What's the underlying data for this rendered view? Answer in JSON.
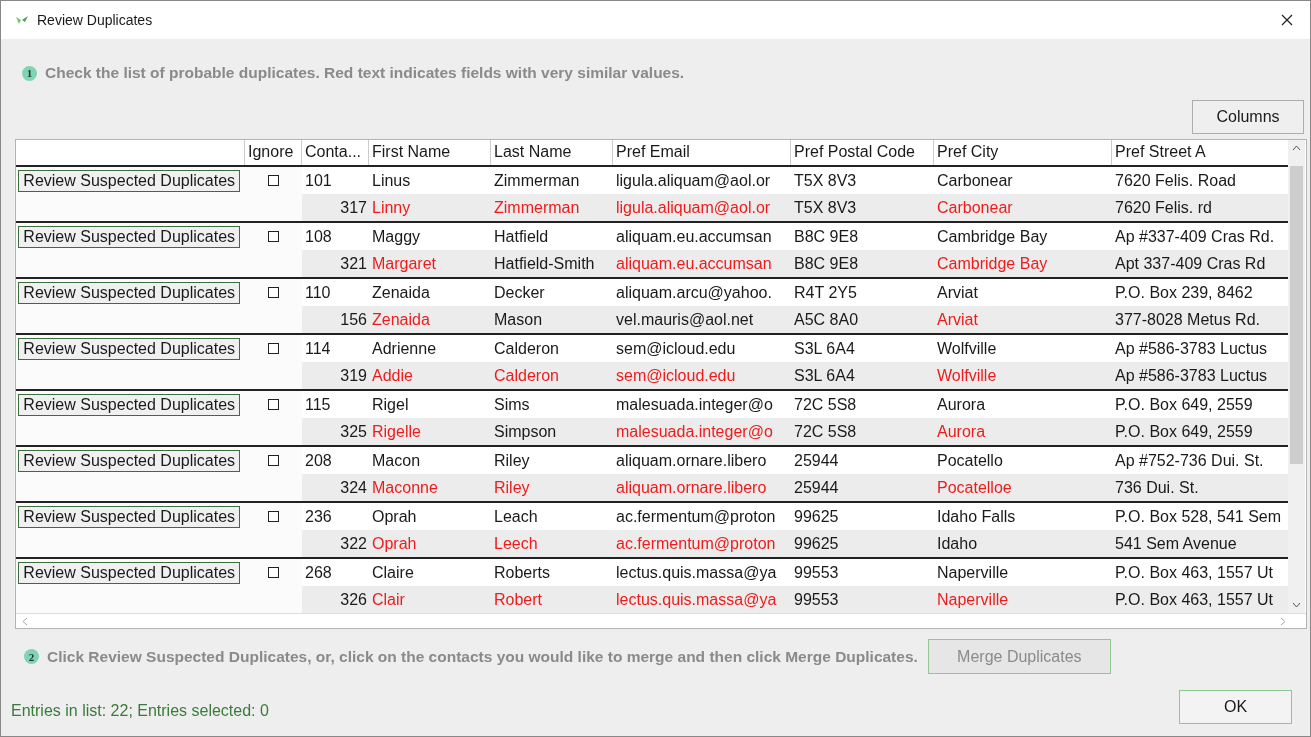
{
  "window": {
    "title": "Review Duplicates"
  },
  "step1": {
    "number": "1",
    "text": "Check the list of probable duplicates. Red text indicates fields with very similar values."
  },
  "columns_button": "Columns",
  "table": {
    "columns": [
      "Ignore",
      "Conta...",
      "First Name",
      "Last Name",
      "Pref Email",
      "Pref Postal Code",
      "Pref City",
      "Pref Street A"
    ],
    "groups": [
      {
        "review_button": "Review Suspected Duplicates",
        "ignored": false,
        "contact": [
          "101",
          "Linus",
          "Zimmerman",
          "ligula.aliquam@aol.or",
          "T5X 8V3",
          "Carbonear",
          "7620 Felis. Road"
        ],
        "duplicate": [
          {
            "text": "317",
            "similar": false
          },
          {
            "text": "Linny",
            "similar": true
          },
          {
            "text": "Zimmerman",
            "similar": true
          },
          {
            "text": "ligula.aliquam@aol.or",
            "similar": true
          },
          {
            "text": "T5X 8V3",
            "similar": false
          },
          {
            "text": "Carbonear",
            "similar": true
          },
          {
            "text": "7620 Felis. rd",
            "similar": false
          }
        ]
      },
      {
        "review_button": "Review Suspected Duplicates",
        "ignored": false,
        "contact": [
          "108",
          "Maggy",
          "Hatfield",
          "aliquam.eu.accumsan",
          "B8C 9E8",
          "Cambridge Bay",
          "Ap #337-409 Cras Rd."
        ],
        "duplicate": [
          {
            "text": "321",
            "similar": false
          },
          {
            "text": "Margaret",
            "similar": true
          },
          {
            "text": "Hatfield-Smith",
            "similar": false
          },
          {
            "text": "aliquam.eu.accumsan",
            "similar": true
          },
          {
            "text": "B8C 9E8",
            "similar": false
          },
          {
            "text": "Cambridge Bay",
            "similar": true
          },
          {
            "text": "Apt 337-409 Cras Rd",
            "similar": false
          }
        ]
      },
      {
        "review_button": "Review Suspected Duplicates",
        "ignored": false,
        "contact": [
          "110",
          "Zenaida",
          "Decker",
          "aliquam.arcu@yahoo.",
          "R4T 2Y5",
          "Arviat",
          "P.O. Box 239, 8462"
        ],
        "duplicate": [
          {
            "text": "156",
            "similar": false
          },
          {
            "text": "Zenaida",
            "similar": true
          },
          {
            "text": "Mason",
            "similar": false
          },
          {
            "text": "vel.mauris@aol.net",
            "similar": false
          },
          {
            "text": "A5C 8A0",
            "similar": false
          },
          {
            "text": "Arviat",
            "similar": true
          },
          {
            "text": "377-8028 Metus Rd.",
            "similar": false
          }
        ]
      },
      {
        "review_button": "Review Suspected Duplicates",
        "ignored": false,
        "contact": [
          "114",
          "Adrienne",
          "Calderon",
          "sem@icloud.edu",
          "S3L 6A4",
          "Wolfville",
          "Ap #586-3783 Luctus"
        ],
        "duplicate": [
          {
            "text": "319",
            "similar": false
          },
          {
            "text": "Addie",
            "similar": true
          },
          {
            "text": "Calderon",
            "similar": true
          },
          {
            "text": "sem@icloud.edu",
            "similar": true
          },
          {
            "text": "S3L 6A4",
            "similar": false
          },
          {
            "text": "Wolfville",
            "similar": true
          },
          {
            "text": "Ap #586-3783 Luctus",
            "similar": false
          }
        ]
      },
      {
        "review_button": "Review Suspected Duplicates",
        "ignored": false,
        "contact": [
          "115",
          "Rigel",
          "Sims",
          "malesuada.integer@o",
          "72C 5S8",
          "Aurora",
          "P.O. Box 649, 2559"
        ],
        "duplicate": [
          {
            "text": "325",
            "similar": false
          },
          {
            "text": "Rigelle",
            "similar": true
          },
          {
            "text": "Simpson",
            "similar": false
          },
          {
            "text": "malesuada.integer@o",
            "similar": true
          },
          {
            "text": "72C 5S8",
            "similar": false
          },
          {
            "text": "Aurora",
            "similar": true
          },
          {
            "text": "P.O. Box 649, 2559",
            "similar": false
          }
        ]
      },
      {
        "review_button": "Review Suspected Duplicates",
        "ignored": false,
        "contact": [
          "208",
          "Macon",
          "Riley",
          "aliquam.ornare.libero",
          "25944",
          "Pocatello",
          "Ap #752-736 Dui. St."
        ],
        "duplicate": [
          {
            "text": "324",
            "similar": false
          },
          {
            "text": "Maconne",
            "similar": true
          },
          {
            "text": "Riley",
            "similar": true
          },
          {
            "text": "aliquam.ornare.libero",
            "similar": true
          },
          {
            "text": "25944",
            "similar": false
          },
          {
            "text": "Pocatelloe",
            "similar": true
          },
          {
            "text": "736 Dui. St.",
            "similar": false
          }
        ]
      },
      {
        "review_button": "Review Suspected Duplicates",
        "ignored": false,
        "contact": [
          "236",
          "Oprah",
          "Leach",
          "ac.fermentum@proton",
          "99625",
          "Idaho Falls",
          "P.O. Box 528, 541 Sem"
        ],
        "duplicate": [
          {
            "text": "322",
            "similar": false
          },
          {
            "text": "Oprah",
            "similar": true
          },
          {
            "text": "Leech",
            "similar": true
          },
          {
            "text": "ac.fermentum@proton",
            "similar": true
          },
          {
            "text": "99625",
            "similar": false
          },
          {
            "text": "Idaho",
            "similar": false
          },
          {
            "text": "541 Sem Avenue",
            "similar": false
          }
        ]
      },
      {
        "review_button": "Review Suspected Duplicates",
        "ignored": false,
        "contact": [
          "268",
          "Claire",
          "Roberts",
          "lectus.quis.massa@ya",
          "99553",
          "Naperville",
          "P.O. Box 463, 1557 Ut"
        ],
        "duplicate": [
          {
            "text": "326",
            "similar": false
          },
          {
            "text": "Clair",
            "similar": true
          },
          {
            "text": "Robert",
            "similar": true
          },
          {
            "text": "lectus.quis.massa@ya",
            "similar": true
          },
          {
            "text": "99553",
            "similar": false
          },
          {
            "text": "Naperville",
            "similar": true
          },
          {
            "text": "P.O. Box 463, 1557 Ut",
            "similar": false
          }
        ]
      }
    ]
  },
  "step2": {
    "number": "2",
    "text": "Click Review Suspected Duplicates, or, click on the contacts you would like to merge and then click Merge Duplicates."
  },
  "merge_button": {
    "label": "Merge Duplicates",
    "disabled": true
  },
  "status_bar": "Entries in list: 22; Entries selected: 0",
  "ok_button": "OK"
}
